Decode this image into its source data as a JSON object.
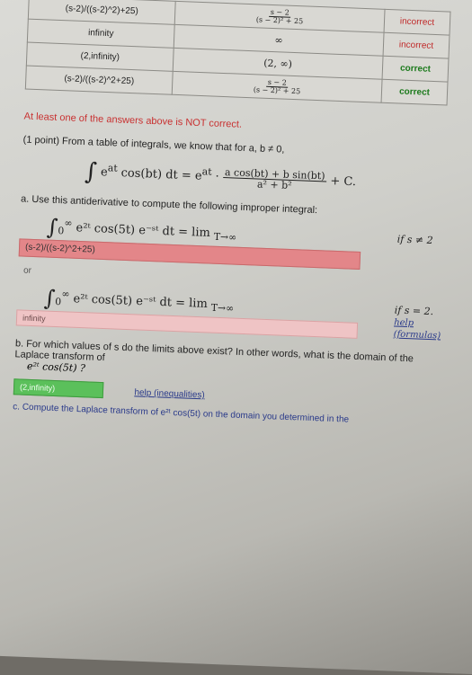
{
  "table": {
    "rows": [
      {
        "answer": "(s-2)/((s-2)^2)+25)",
        "preview_num": "s − 2",
        "preview_den": "(s − 2)² + 25",
        "result": "incorrect",
        "status": "bad"
      },
      {
        "answer": "infinity",
        "preview_text": "∞",
        "result": "incorrect",
        "status": "bad"
      },
      {
        "answer": "(2,infinity)",
        "preview_text": "(2, ∞)",
        "result": "correct",
        "status": "good"
      },
      {
        "answer": "(s-2)/((s-2)^2+25)",
        "preview_num": "s − 2",
        "preview_den": "(s − 2)² + 25",
        "result": "correct",
        "status": "good"
      }
    ]
  },
  "warning": "At least one of the answers above is NOT correct.",
  "problem": {
    "statement": "(1 point) From a table of integrals, we know that for a, b ≠ 0,",
    "formula": "∫ e^{at} cos(bt) dt = e^{at} · (a cos(bt) + b sin(bt)) / (a² + b²) + C.",
    "formula_lhs": "e",
    "formula_rhs_text": "cos(bt) dt = e",
    "formula_frac_num": "a cos(bt) + b sin(bt)",
    "formula_frac_den": "a² + b²",
    "formula_tail": "+ C.",
    "part_a": "a. Use this antiderivative to compute the following improper integral:",
    "int1_text": "e²ᵗ cos(5t) e⁻ˢᵗ dt = lim",
    "int1_limit": "T→∞",
    "int1_cond": "if s ≠ 2",
    "int1_answer": "(s-2)/((s-2)^2+25)",
    "or": "or",
    "int2_text": "e²ᵗ cos(5t) e⁻ˢᵗ dt = lim",
    "int2_limit": "T→∞",
    "int2_cond": "if s = 2.",
    "int2_help": "help (formulas)",
    "int2_answer": "infinity",
    "part_b": "b. For which values of s do the limits above exist? In other words, what is the domain of the Laplace transform of",
    "part_b_expr": "e²ᵗ cos(5t) ?",
    "part_b_answer": "(2,infinity)",
    "part_b_help": "help (inequalities)",
    "part_c": "c. Compute the Laplace transform of e²ᵗ cos(5t) on the domain you determined in the"
  }
}
